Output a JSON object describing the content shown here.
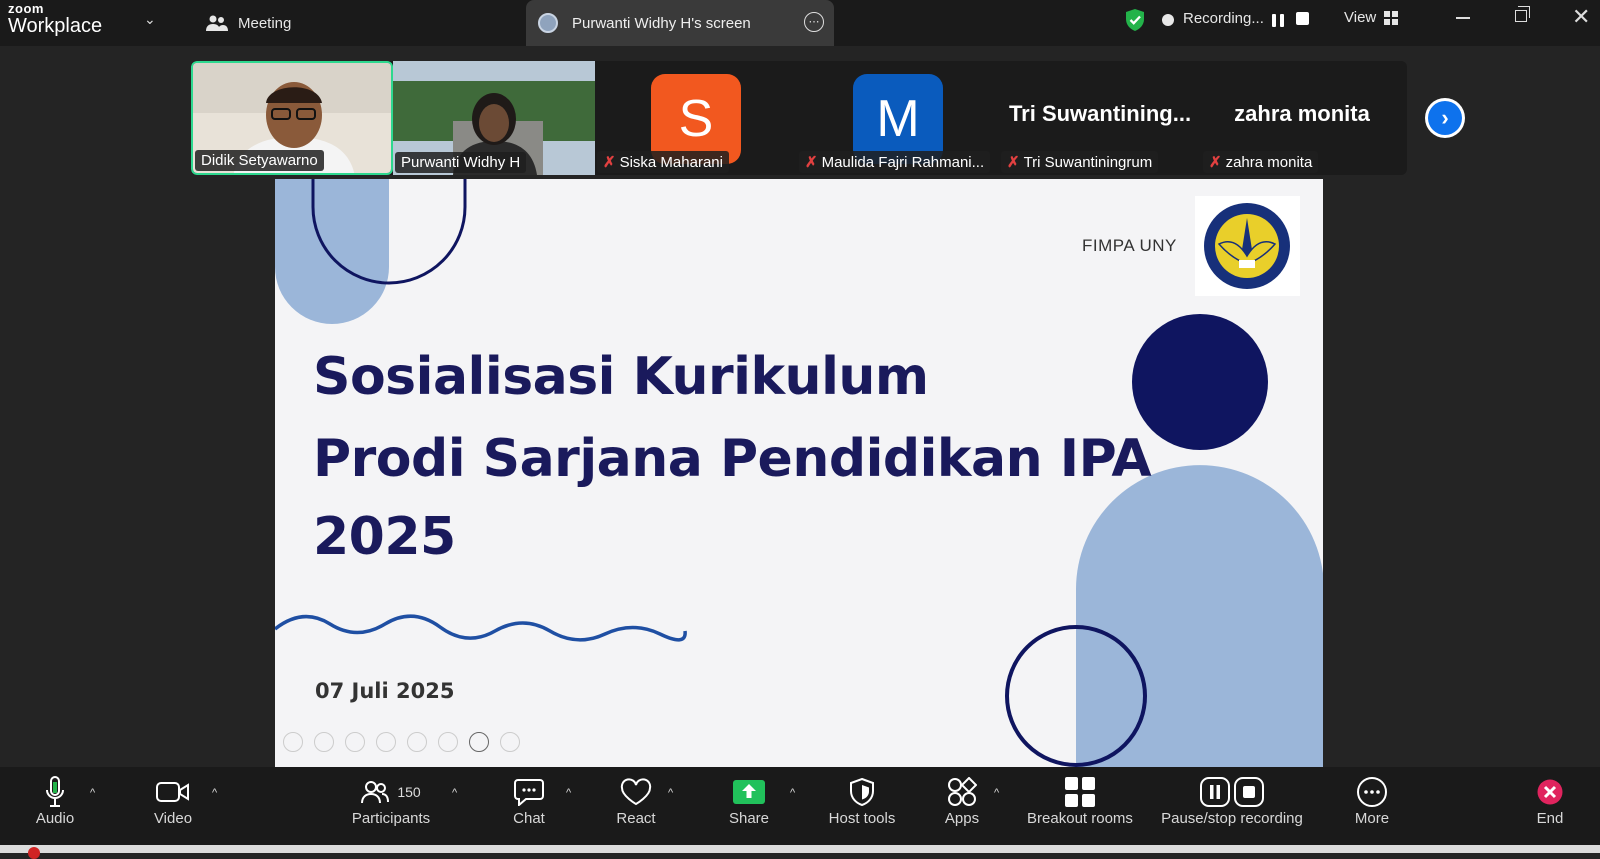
{
  "app": {
    "brand_top": "zoom",
    "brand_bottom": "Workplace"
  },
  "titlebar": {
    "meeting_label": "Meeting",
    "screen_tab_label": "Purwanti Widhy H's screen",
    "recording_label": "Recording...",
    "view_label": "View"
  },
  "participants_strip": [
    {
      "name": "Didik Setyawarno",
      "type": "video",
      "active": true
    },
    {
      "name": "Purwanti Widhy H",
      "type": "video"
    },
    {
      "name": "Siska Maharani",
      "type": "avatar",
      "initial": "S",
      "color": "#f2581f",
      "muted": true
    },
    {
      "name": "Maulida Fajri Rahmani...",
      "type": "avatar",
      "initial": "M",
      "color": "#0a5bbd",
      "muted": true
    },
    {
      "name": "Tri Suwantiningrum",
      "display": "Tri  Suwantining...",
      "type": "name",
      "muted": true
    },
    {
      "name": "zahra monita",
      "display": "zahra monita",
      "type": "name",
      "muted": true
    }
  ],
  "slide": {
    "org_label": "FIMPA UNY",
    "title_line1": "Sosialisasi Kurikulum",
    "title_line2": "Prodi Sarjana Pendidikan IPA",
    "title_line3": "2025",
    "date": "07 Juli 2025",
    "logo_text": "UNIVERSITAS NEGERI YOGYAKARTA"
  },
  "toolbar": {
    "audio": "Audio",
    "video": "Video",
    "participants": "Participants",
    "participants_count": "150",
    "chat": "Chat",
    "react": "React",
    "share": "Share",
    "host_tools": "Host tools",
    "apps": "Apps",
    "breakout_rooms": "Breakout rooms",
    "pause_stop_recording": "Pause/stop recording",
    "more": "More",
    "end": "End"
  },
  "colors": {
    "accent_green": "#2ed88f",
    "share_green": "#21c15b",
    "end_red": "#e0245e",
    "slide_navy": "#0f1560",
    "slide_lightblue": "#9bb6d9"
  }
}
